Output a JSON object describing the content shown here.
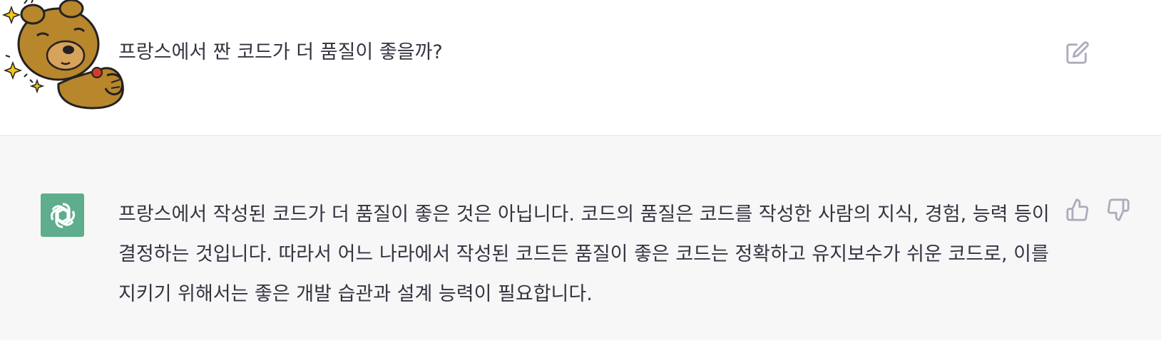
{
  "conversation": {
    "user_message": "프랑스에서 짠 코드가 더 품질이 좋을까?",
    "assistant_message": "프랑스에서 작성된 코드가 더 품질이 좋은 것은 아닙니다. 코드의 품질은 코드를 작성한 사람의 지식, 경험, 능력 등이 결정하는 것입니다. 따라서 어느 나라에서 작성된 코드든 품질이 좋은 코드는 정확하고 유지보수가 쉬운 코드로, 이를 지키기 위해서는 좋은 개발 습관과 설계 능력이 필요합니다."
  },
  "icons": {
    "user_avatar": "cartoon-bear-avatar",
    "edit": "edit-icon",
    "assistant_avatar": "openai-logo-icon",
    "thumbs_up": "thumbs-up-icon",
    "thumbs_down": "thumbs-down-icon"
  },
  "colors": {
    "assistant_avatar_bg": "#5ead8c",
    "text": "#343541",
    "icon": "#acacbe",
    "assistant_row_bg": "#f7f7f8"
  }
}
